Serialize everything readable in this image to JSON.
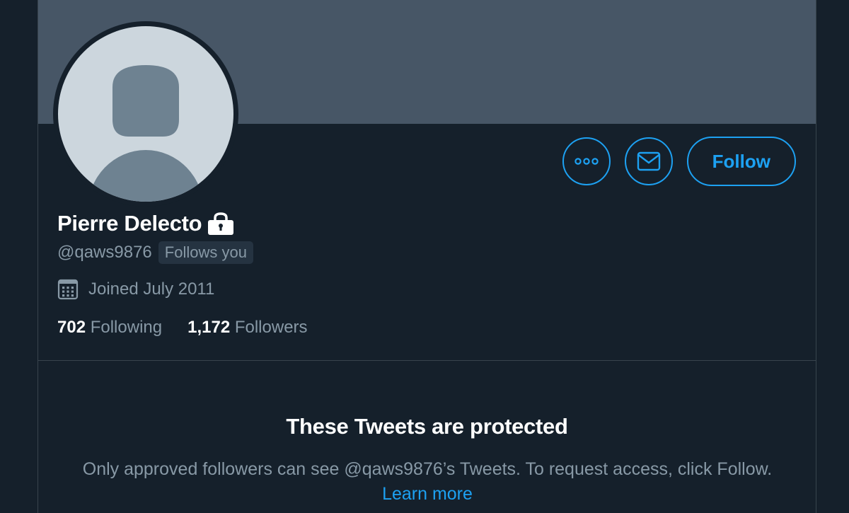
{
  "profile": {
    "display_name": "Pierre Delecto",
    "handle": "@qaws9876",
    "follows_you_badge": "Follows you",
    "joined": "Joined July 2011",
    "following_count": "702",
    "following_label": "Following",
    "followers_count": "1,172",
    "followers_label": "Followers",
    "protected_icon": "lock-icon"
  },
  "actions": {
    "more_icon": "more-icon",
    "message_icon": "envelope-icon",
    "follow_label": "Follow"
  },
  "protected_notice": {
    "title": "These Tweets are protected",
    "body": "Only approved followers can see @qaws9876’s Tweets. To request access, click Follow.",
    "learn_more": "Learn more"
  },
  "colors": {
    "background": "#15202b",
    "banner": "#475666",
    "accent": "#1da1f2",
    "secondary_text": "#8899a6",
    "border": "#38444d"
  }
}
